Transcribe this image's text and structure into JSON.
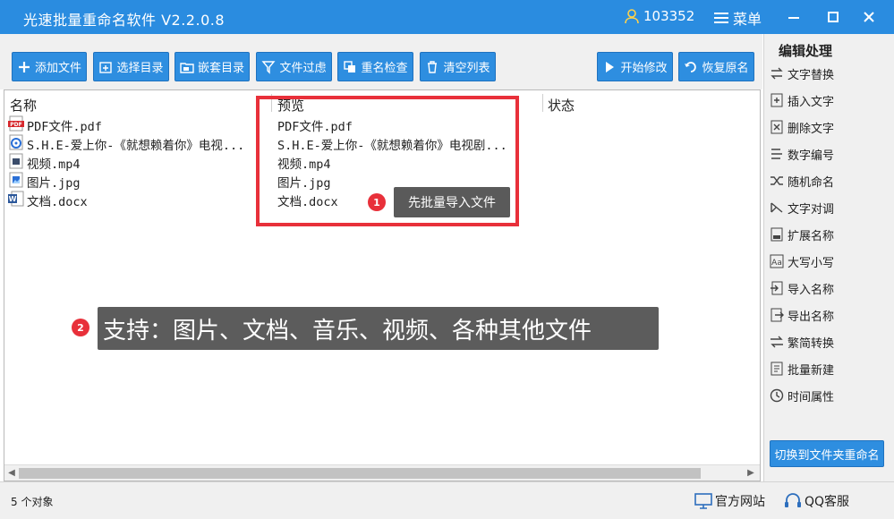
{
  "window": {
    "title": "光速批量重命名软件 V2.2.0.8",
    "user_id": "103352",
    "menu_label": "菜单"
  },
  "toolbar": {
    "add_files": "添加文件",
    "select_dir": "选择目录",
    "nested_dir": "嵌套目录",
    "file_filter": "文件过虑",
    "dup_check": "重名检查",
    "clear_list": "清空列表",
    "start_modify": "开始修改",
    "restore_name": "恢复原名"
  },
  "columns": {
    "name": "名称",
    "preview": "预览",
    "status": "状态"
  },
  "files": [
    {
      "name": "PDF文件.pdf",
      "preview": "PDF文件.pdf",
      "icon": "pdf-icon"
    },
    {
      "name": "S.H.E-爱上你-《就想赖着你》电视...",
      "preview": "S.H.E-爱上你-《就想赖着你》电视剧...",
      "icon": "audio-icon"
    },
    {
      "name": "视频.mp4",
      "preview": "视频.mp4",
      "icon": "video-icon"
    },
    {
      "name": "图片.jpg",
      "preview": "图片.jpg",
      "icon": "image-icon"
    },
    {
      "name": "文档.docx",
      "preview": "文档.docx",
      "icon": "word-icon"
    }
  ],
  "annotations": {
    "step1_num": "1",
    "step1_text": "先批量导入文件",
    "step2_num": "2",
    "step2_text": "支持：图片、文档、音乐、视频、各种其他文件"
  },
  "side_panel": {
    "title": "编辑处理",
    "items": [
      "文字替换",
      "插入文字",
      "删除文字",
      "数字编号",
      "随机命名",
      "文字对调",
      "扩展名称",
      "大写小写",
      "导入名称",
      "导出名称",
      "繁简转换",
      "批量新建",
      "时间属性"
    ],
    "switch_label": "切换到文件夹重命名"
  },
  "statusbar": {
    "count": "5 个对象",
    "website": "官方网站",
    "qq": "QQ客服"
  },
  "colors": {
    "titlebar": "#2a8ce0",
    "button": "#2e8ee0",
    "highlight_red": "#e8303a"
  }
}
